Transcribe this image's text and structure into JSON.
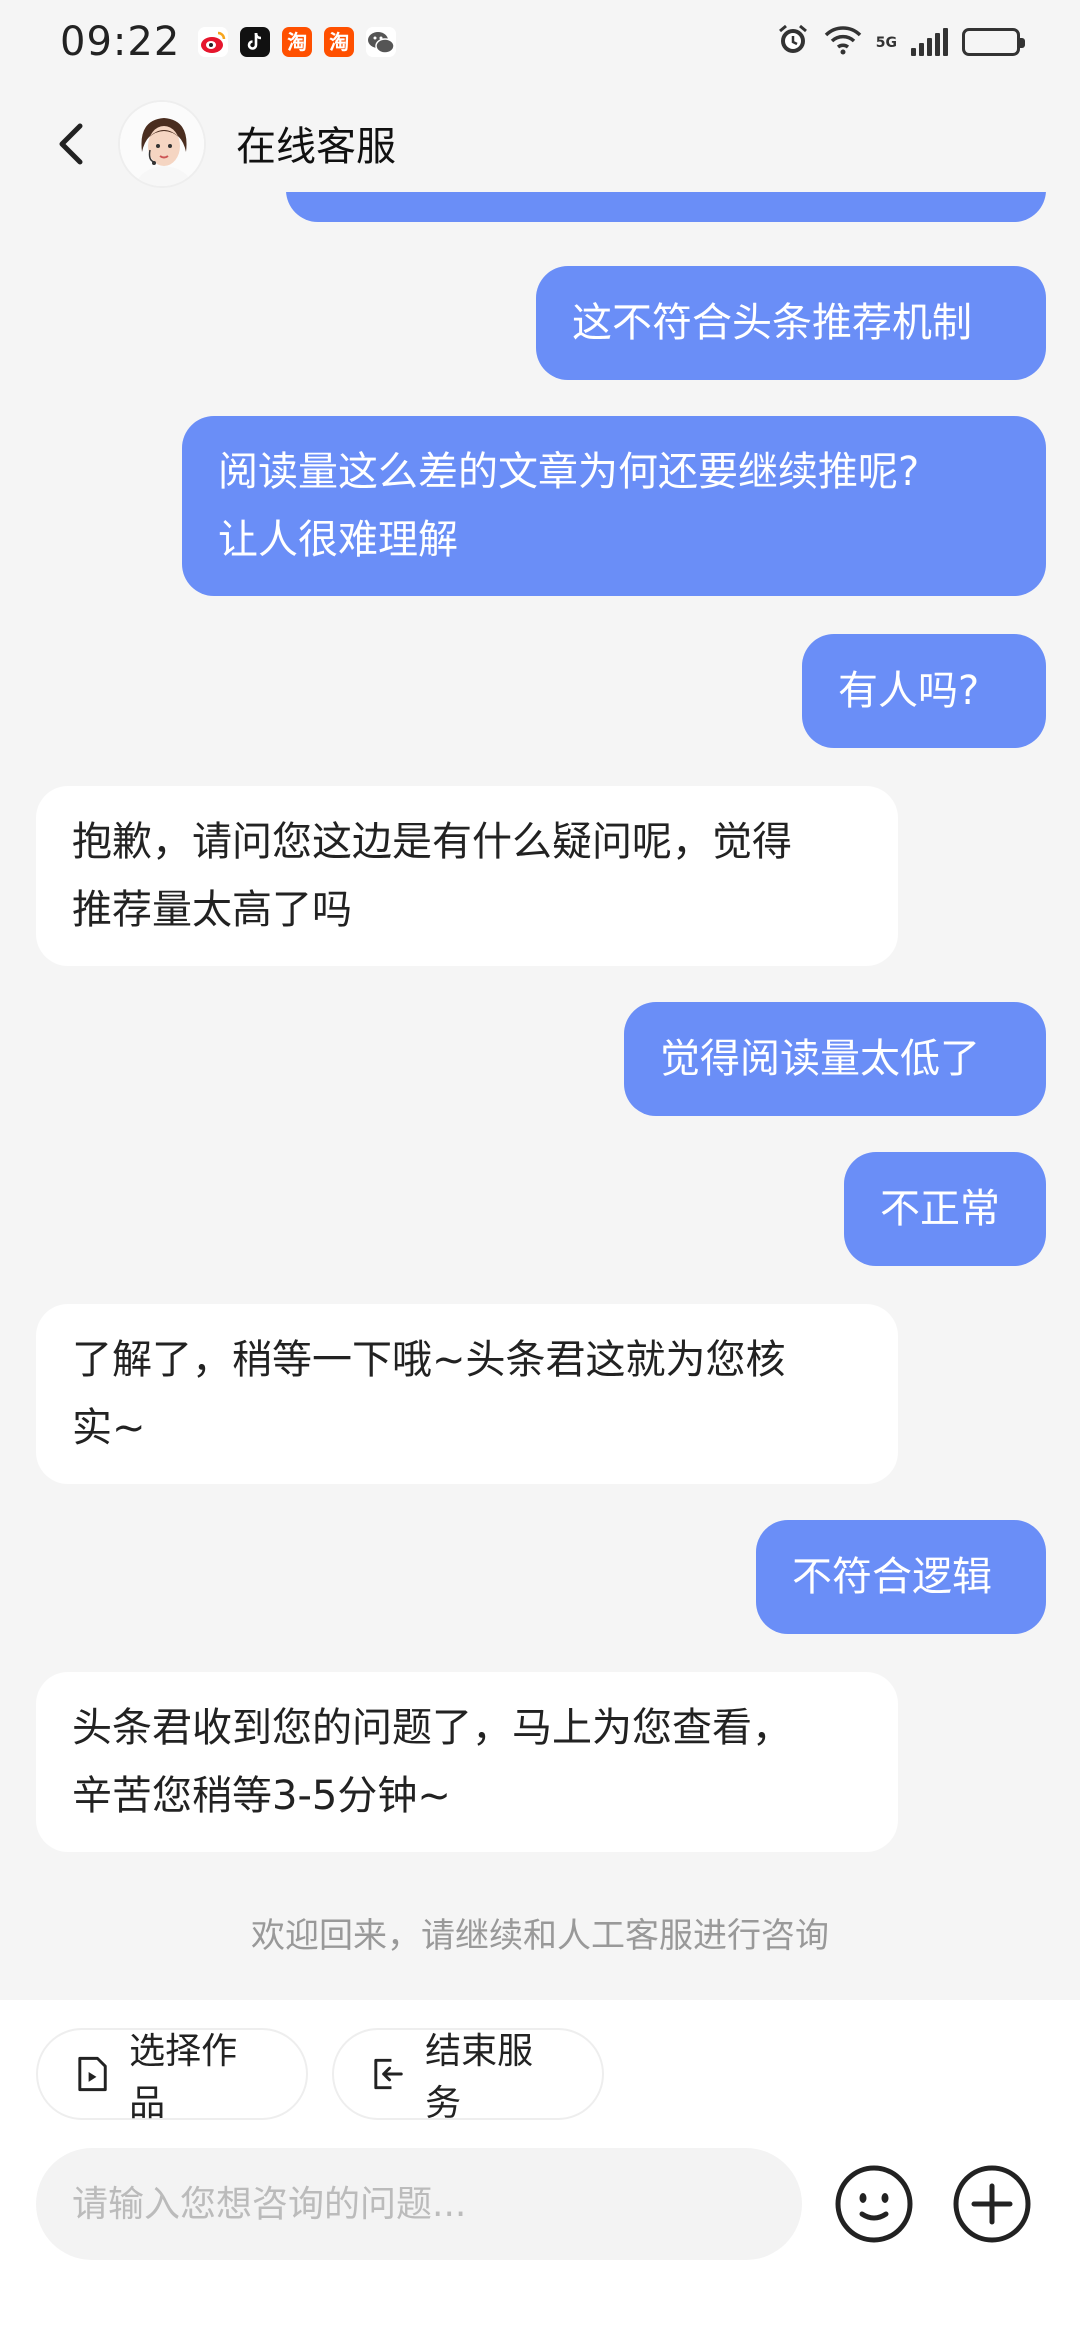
{
  "status_bar": {
    "time": "09:22",
    "network": "5G",
    "app_icons": [
      "weibo-icon",
      "tiktok-icon",
      "taobao-icon",
      "taobao-icon",
      "wechat-icon"
    ],
    "battery_level": 0.85
  },
  "header": {
    "title": "在线客服",
    "avatar": "customer-service-avatar"
  },
  "messages": [
    {
      "from": "me",
      "lines": [
        ""
      ]
    },
    {
      "from": "me",
      "lines": [
        "这不符合头条推荐机制"
      ]
    },
    {
      "from": "me",
      "lines": [
        "阅读量这么差的文章为何还要继续推呢?",
        "让人很难理解"
      ]
    },
    {
      "from": "me",
      "lines": [
        "有人吗?"
      ]
    },
    {
      "from": "them",
      "lines": [
        "抱歉，请问您这边是有什么疑问呢，觉得",
        "推荐量太高了吗"
      ]
    },
    {
      "from": "me",
      "lines": [
        "觉得阅读量太低了"
      ]
    },
    {
      "from": "me",
      "lines": [
        "不正常"
      ]
    },
    {
      "from": "them",
      "lines": [
        "了解了，稍等一下哦~头条君这就为您核",
        "实~"
      ]
    },
    {
      "from": "me",
      "lines": [
        "不符合逻辑"
      ]
    },
    {
      "from": "them",
      "lines": [
        "头条君收到您的问题了，马上为您查看，",
        "辛苦您稍等3-5分钟~"
      ]
    }
  ],
  "system_hint": "欢迎回来，请继续和人工客服进行咨询",
  "actions": {
    "select_work": "选择作品",
    "end_service": "结束服务"
  },
  "composer": {
    "placeholder": "请输入您想咨询的问题..."
  },
  "colors": {
    "my_bubble": "#6a8ef7",
    "their_bubble": "#ffffff",
    "background": "#f5f5f5"
  }
}
